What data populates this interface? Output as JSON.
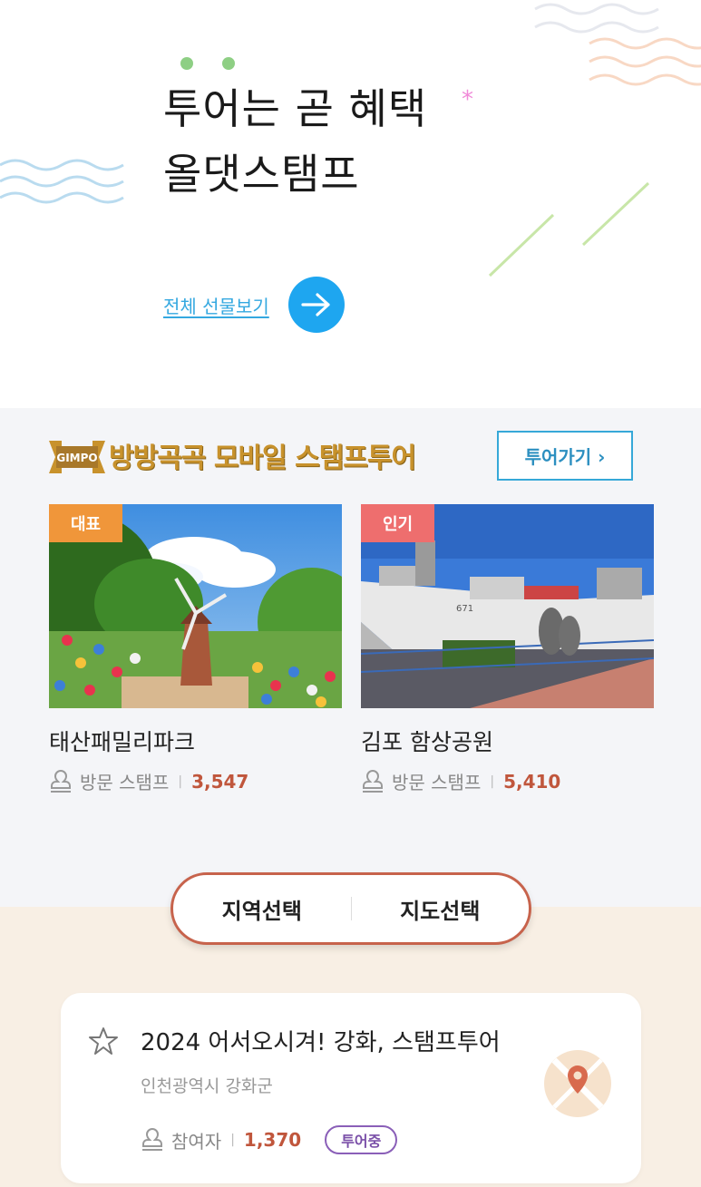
{
  "hero": {
    "title_line1": "투어는 곧 혜택",
    "title_line2": "올댓스탬프",
    "all_gifts_link": "전체 선물보기"
  },
  "tour_section": {
    "logo_text": "GIMPO",
    "title": "방방곡곡 모바일 스탬프투어",
    "go_button": "투어가기 ›",
    "cards": [
      {
        "tag": "대표",
        "name": "태산패밀리파크",
        "stamp_label": "방문 스탬프",
        "count": "3,547"
      },
      {
        "tag": "인기",
        "name": "김포 함상공원",
        "stamp_label": "방문 스탬프",
        "count": "5,410"
      }
    ]
  },
  "selector": {
    "region": "지역선택",
    "map": "지도선택"
  },
  "tour_card": {
    "name": "2024 어서오시겨! 강화, 스탬프투어",
    "location": "인천광역시 강화군",
    "participants_label": "참여자",
    "participants": "1,370",
    "status": "투어중"
  },
  "colors": {
    "accent_blue": "#1ea6f0",
    "brand_gold": "#c8922c",
    "tag_orange": "#f0963a",
    "tag_red": "#ee6e6e",
    "count_red": "#c0563c",
    "status_purple": "#8a5fb8"
  }
}
